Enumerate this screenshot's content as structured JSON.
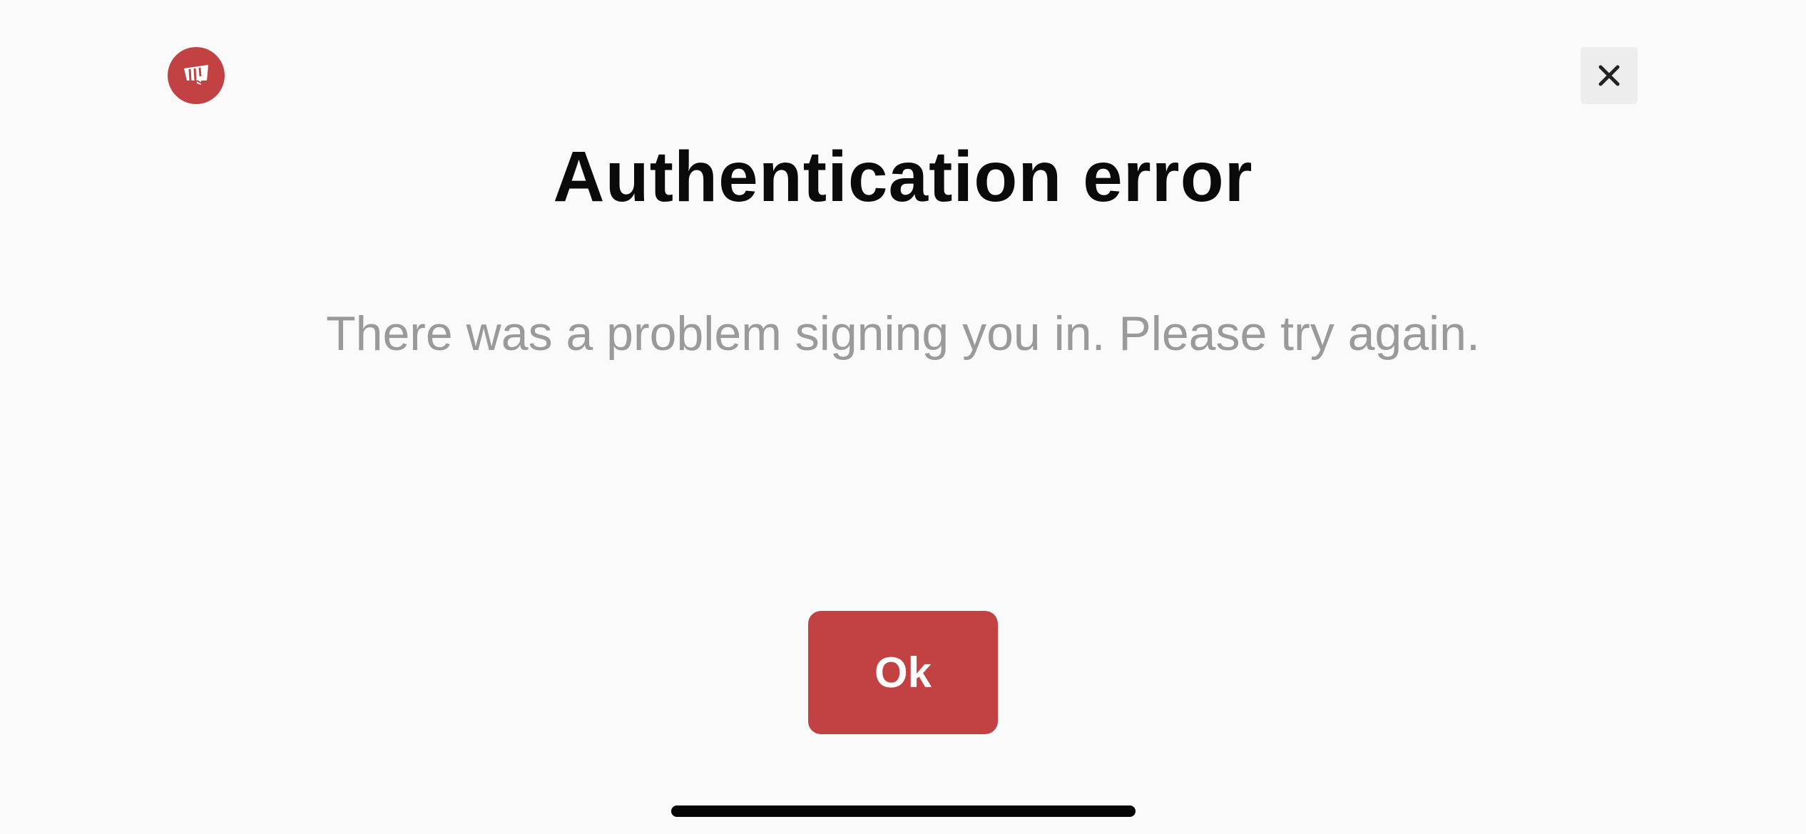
{
  "header": {
    "logo_icon": "riot-fist-icon",
    "close_icon": "close-icon",
    "accent_color": "#c24243"
  },
  "dialog": {
    "title": "Authentication error",
    "message": "There was a problem signing you in. Please try again.",
    "ok_label": "Ok"
  }
}
